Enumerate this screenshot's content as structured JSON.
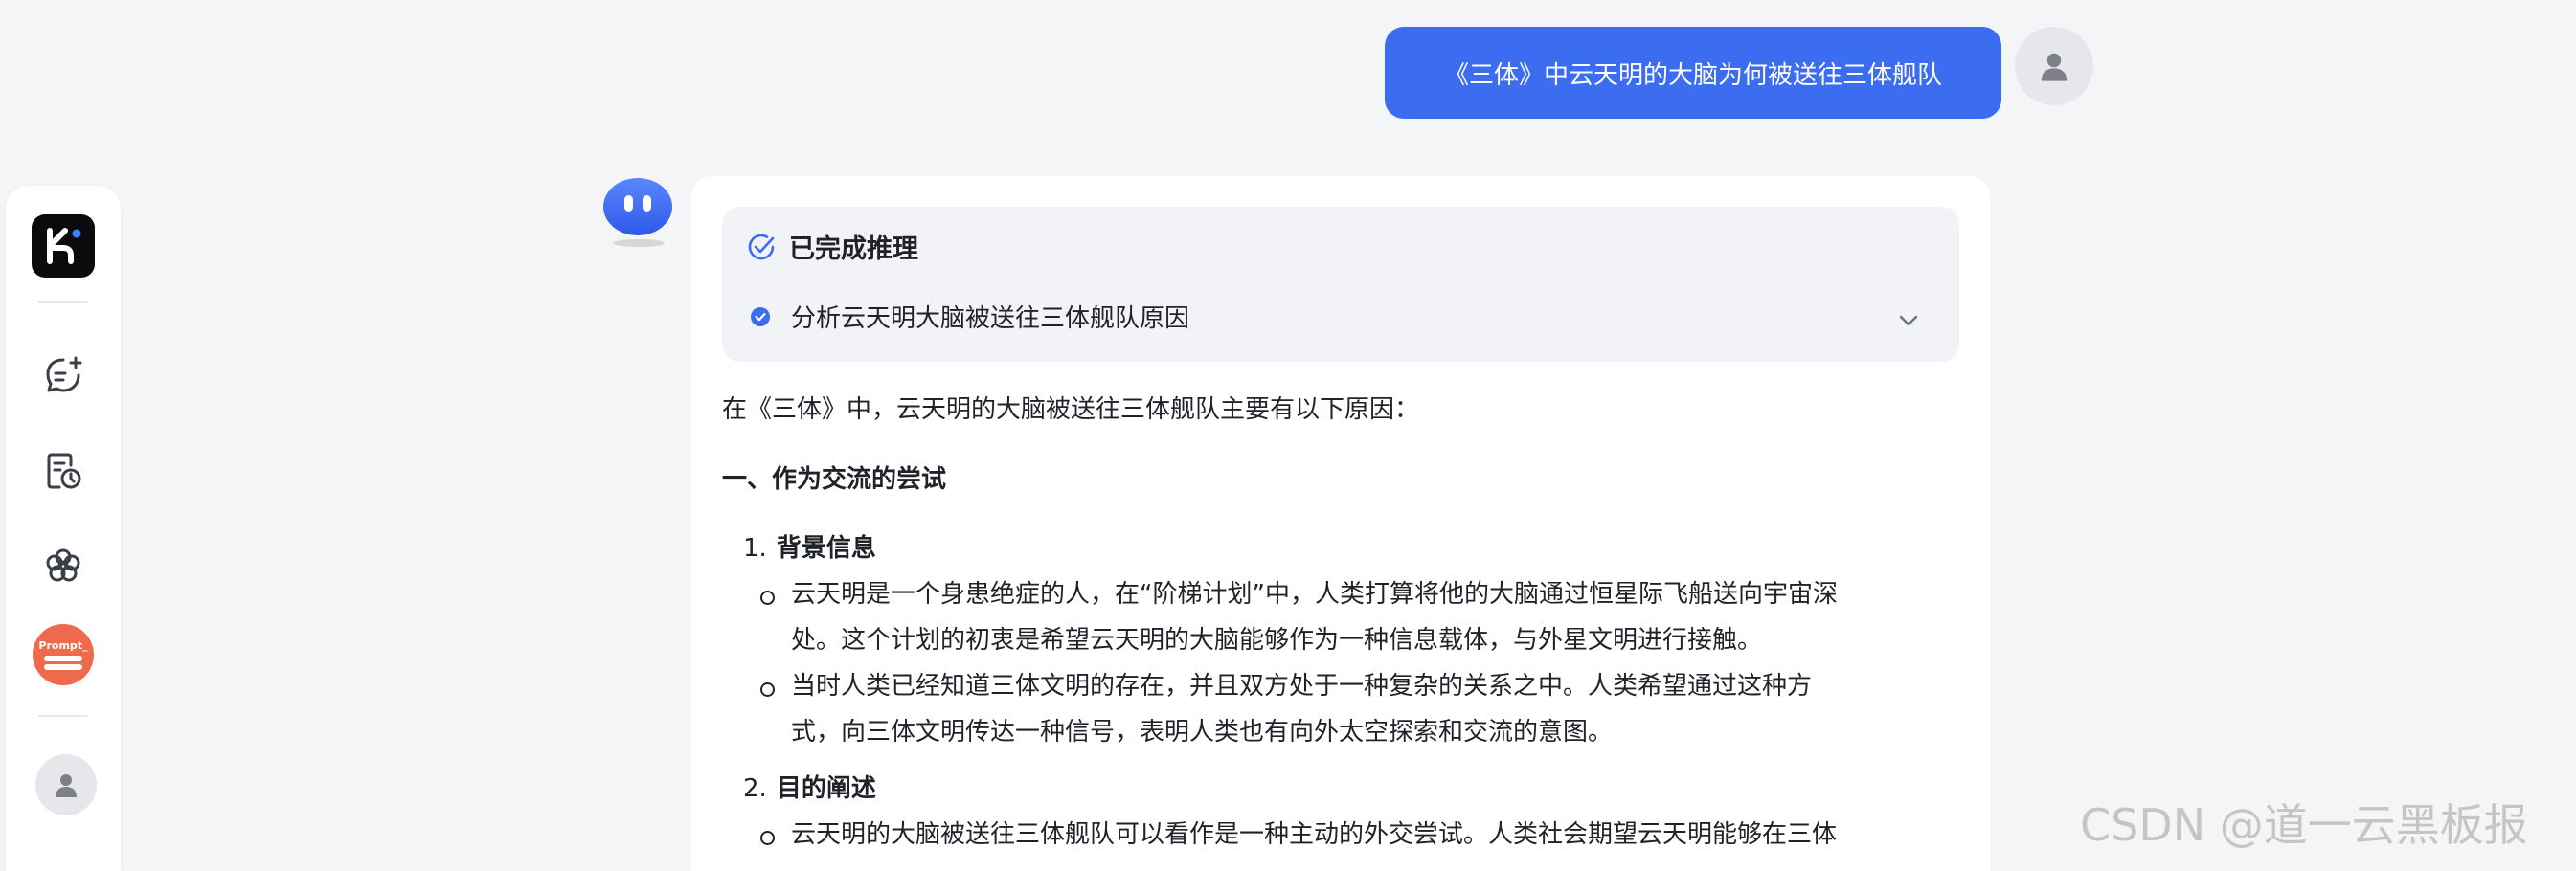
{
  "user_message": "《三体》中云天明的大脑为何被送往三体舰队",
  "reasoning": {
    "status_title": "已完成推理",
    "step": "分析云天明大脑被送往三体舰队原因"
  },
  "answer": {
    "intro": "在《三体》中，云天明的大脑被送往三体舰队主要有以下原因：",
    "section1_title": "一、作为交流的尝试",
    "item1": {
      "num": "1.",
      "title": "背景信息",
      "bullets": [
        {
          "line1": "云天明是一个身患绝症的人，在“阶梯计划”中，人类打算将他的大脑通过恒星际飞船送向宇宙深",
          "line2": "处。这个计划的初衷是希望云天明的大脑能够作为一种信息载体，与外星文明进行接触。"
        },
        {
          "line1": "当时人类已经知道三体文明的存在，并且双方处于一种复杂的关系之中。人类希望通过这种方",
          "line2": "式，向三体文明传达一种信号，表明人类也有向外太空探索和交流的意图。"
        }
      ]
    },
    "item2": {
      "num": "2.",
      "title": "目的阐述",
      "bullets": [
        {
          "line1": "云天明的大脑被送往三体舰队可以看作是一种主动的外交尝试。人类社会期望云天明能够在三体",
          "line2": ""
        }
      ]
    }
  },
  "sidebar": {
    "logo_letter": "K",
    "prompt_label": "Prompt_"
  },
  "watermark": "CSDN @道一云黑板报",
  "colors": {
    "accent": "#3c6df0",
    "prompt_badge": "#ef6a4c",
    "page_bg": "#f4f5f7",
    "card_bg": "#ffffff",
    "reason_bg": "#f1f3f7"
  },
  "icons": {
    "new_chat": "chat-plus-icon",
    "history": "history-doc-icon",
    "explore": "flower-icon",
    "reason_done": "check-circle-icon",
    "step": "check-dot-icon",
    "expand": "chevron-down-icon"
  }
}
